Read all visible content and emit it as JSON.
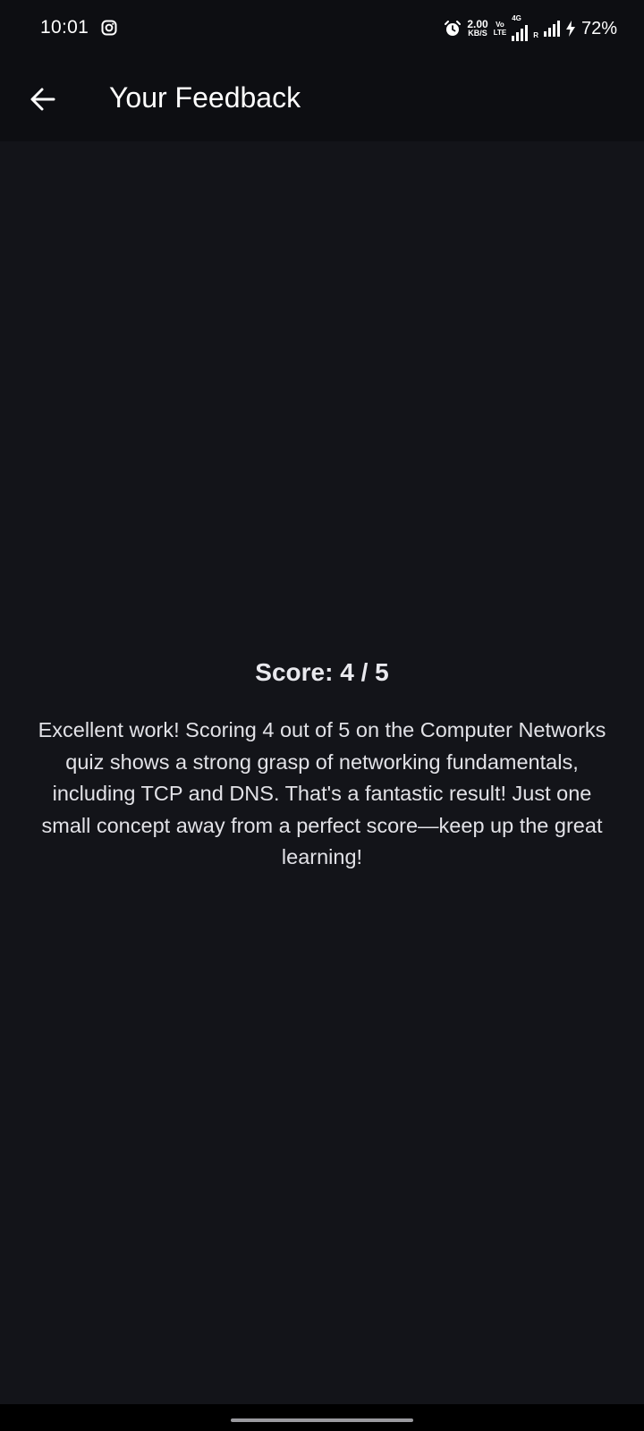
{
  "status_bar": {
    "time": "10:01",
    "net_speed_value": "2.00",
    "net_speed_unit": "KB/S",
    "volte_top": "Vo",
    "volte_bottom": "LTE",
    "network_type": "4G",
    "roaming": "R",
    "battery": "72%",
    "icons": [
      "instagram-icon",
      "alarm-icon",
      "signal-icon",
      "charging-icon"
    ]
  },
  "app_bar": {
    "title": "Your Feedback",
    "back_icon": "arrow-left-icon"
  },
  "main": {
    "score": "Score: 4 / 5",
    "feedback": "Excellent work! Scoring 4 out of 5 on the Computer Networks quiz shows a strong grasp of networking fundamentals, including TCP and DNS. That's a fantastic result! Just one small concept away from a perfect score—keep up the great learning!"
  },
  "colors": {
    "background": "#131419",
    "bar_background": "#0d0e12",
    "text": "#e6e6ea"
  }
}
